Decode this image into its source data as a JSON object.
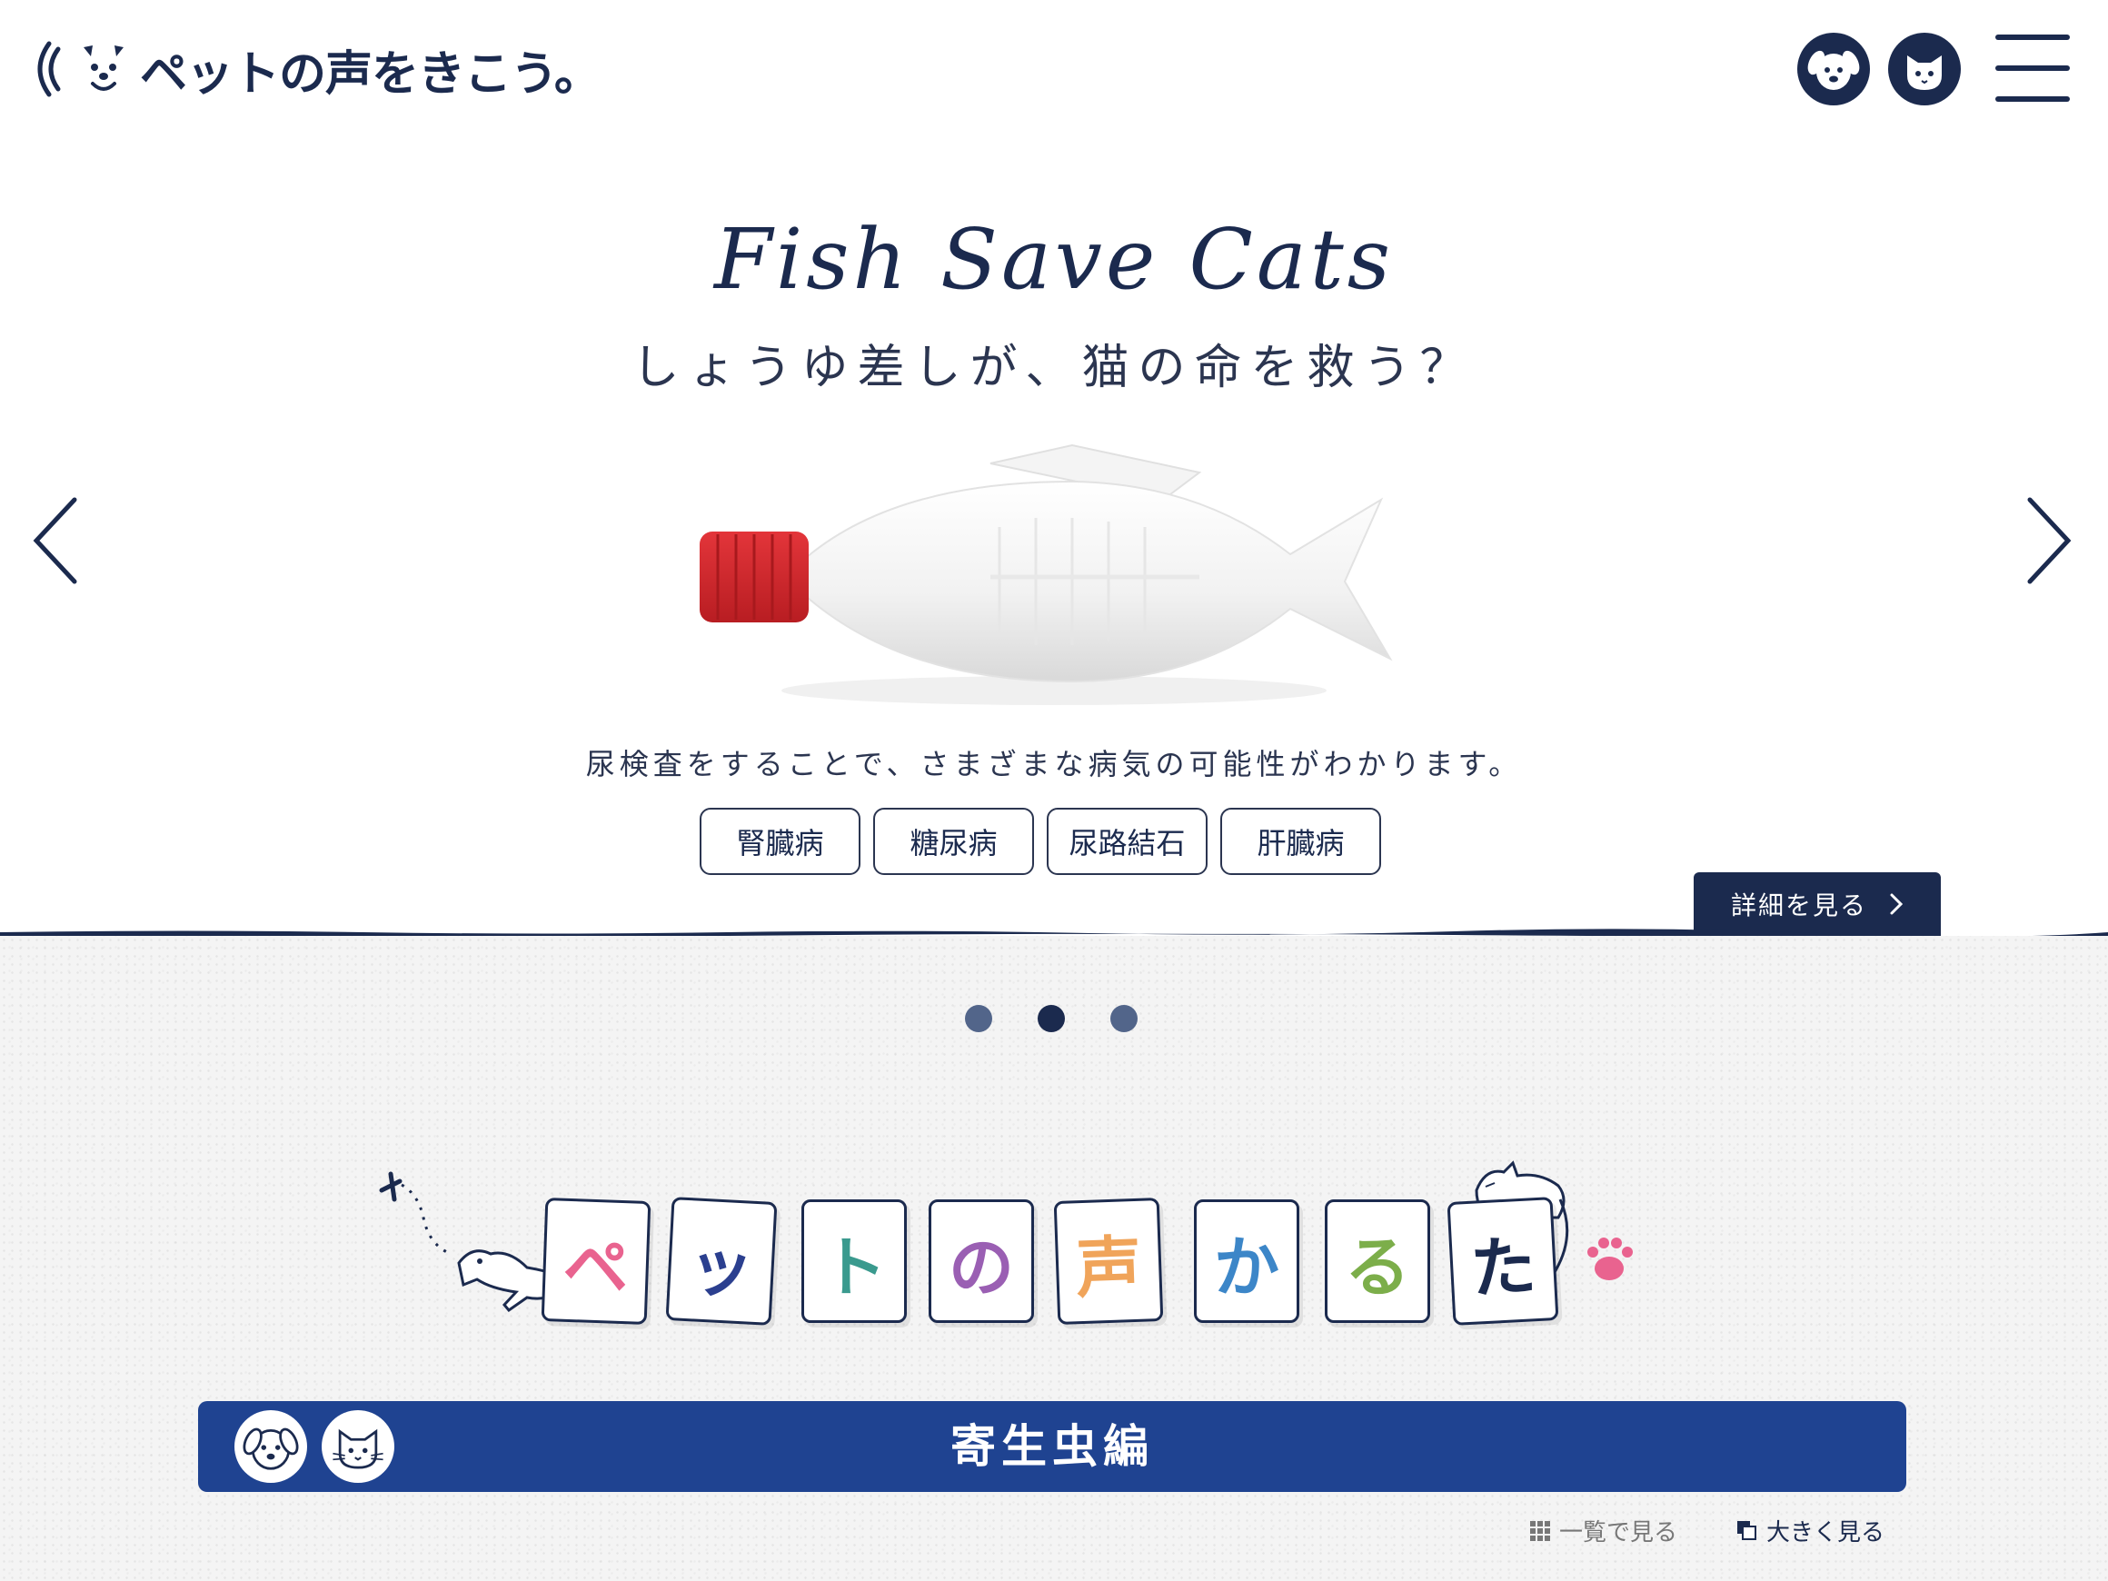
{
  "header": {
    "logo_text": "ペットの声をきこう。",
    "dog_button_icon": "dog-face-icon",
    "cat_button_icon": "cat-face-icon",
    "menu_icon": "hamburger-menu-icon"
  },
  "slide": {
    "title_en": "Fish Save Cats",
    "title_ja": "しょうゆ差しが、猫の命を救う？",
    "description": "尿検査をすることで、さまざまな病気の可能性がわかります。",
    "tags": [
      "腎臓病",
      "糖尿病",
      "尿路結石",
      "肝臓病"
    ],
    "detail_label": "詳細を見る",
    "prev_icon": "chevron-left-icon",
    "next_icon": "chevron-right-icon"
  },
  "carousel": {
    "dot_count": 3,
    "active_index": 1
  },
  "karuta": {
    "cards": [
      {
        "char": "ペ",
        "color": "#e9638f"
      },
      {
        "char": "ッ",
        "color": "#2b3f8f"
      },
      {
        "char": "ト",
        "color": "#3a9a8e"
      },
      {
        "char": "の",
        "color": "#9a5fb3"
      },
      {
        "char": "声",
        "color": "#f0a45a"
      },
      {
        "char": "か",
        "color": "#3c86c8"
      },
      {
        "char": "る",
        "color": "#7cae4a"
      },
      {
        "char": "た",
        "color": "#1b2a4e"
      }
    ]
  },
  "category": {
    "title": "寄生虫編"
  },
  "view_links": {
    "list_label": "一覧で見る",
    "large_label": "大きく見る"
  },
  "colors": {
    "navy": "#1b2a4e",
    "category_blue": "#1f4391",
    "cap_red": "#d9262b"
  }
}
